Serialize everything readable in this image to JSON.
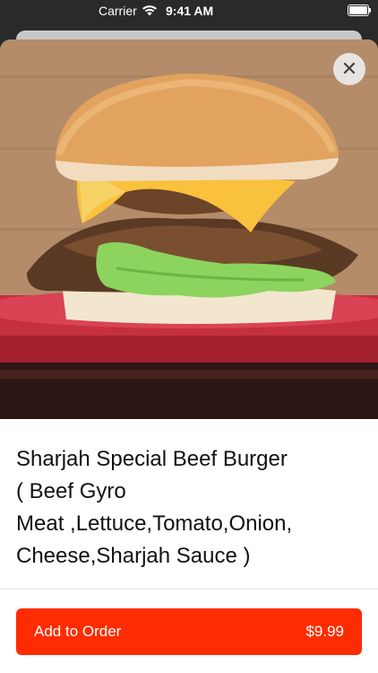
{
  "status_bar": {
    "carrier": "Carrier",
    "time": "9:41 AM",
    "wifi_icon": "wifi-icon",
    "battery_icon": "battery-icon"
  },
  "product": {
    "title": "Sharjah Special Beef Burger\n( Beef Gyro\nMeat ,Lettuce,Tomato,Onion,\nCheese,Sharjah Sauce )",
    "image": "beef-burger-photo"
  },
  "close_button": {
    "icon": "close-icon",
    "glyph": "✕"
  },
  "order_button": {
    "label": "Add to Order",
    "price": "$9.99",
    "color": "#fe2c00"
  }
}
